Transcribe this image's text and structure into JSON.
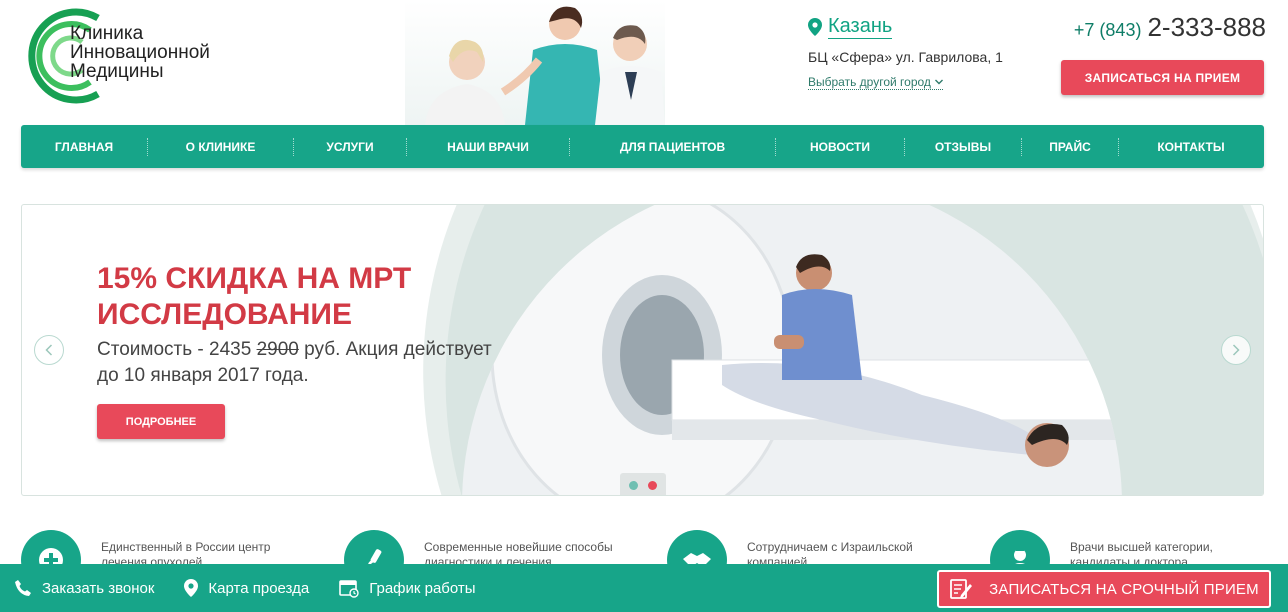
{
  "logo": {
    "lines": [
      "Клиника",
      "Инновационной",
      "Медицины"
    ]
  },
  "header": {
    "city": "Казань",
    "address": "БЦ «Сфера» ул. Гаврилова, 1",
    "change_city": "Выбрать другой город",
    "phone_code": "+7 (843)",
    "phone_number": "2-333-888",
    "appoint_button": "ЗАПИСАТЬСЯ НА ПРИЕМ"
  },
  "nav": {
    "items": [
      {
        "label": "ГЛАВНАЯ"
      },
      {
        "label": "О КЛИНИКЕ"
      },
      {
        "label": "УСЛУГИ"
      },
      {
        "label": "НАШИ ВРАЧИ"
      },
      {
        "label": "ДЛЯ ПАЦИЕНТОВ"
      },
      {
        "label": "НОВОСТИ"
      },
      {
        "label": "ОТЗЫВЫ"
      },
      {
        "label": "ПРАЙС"
      },
      {
        "label": "КОНТАКТЫ"
      }
    ]
  },
  "slider": {
    "title": "15% СКИДКА НА МРТ ИССЛЕДОВАНИЕ",
    "text_prefix": "Стоимость - 2435 ",
    "old_price": "2900",
    "text_suffix": " руб. Акция действует до 10 января 2017 года.",
    "more_button": "ПОДРОБНЕЕ",
    "dot_colors": [
      "#6fbfb2",
      "#e8495a"
    ]
  },
  "features": [
    {
      "text": "Единственный в России центр лечения опухолей"
    },
    {
      "text": "Современные новейшие способы диагностики и лечения"
    },
    {
      "text": "Сотрудничаем с Израильской компанией"
    },
    {
      "text": "Врачи высшей категории, кандидаты и доктора"
    }
  ],
  "bottombar": {
    "callback": "Заказать звонок",
    "map": "Карта проезда",
    "schedule": "График работы",
    "urgent_button": "ЗАПИСАТЬСЯ НА СРОЧНЫЙ ПРИЕМ"
  },
  "colors": {
    "accent": "#17a589",
    "brand_red": "#e8495a",
    "title_red": "#d23a45"
  }
}
